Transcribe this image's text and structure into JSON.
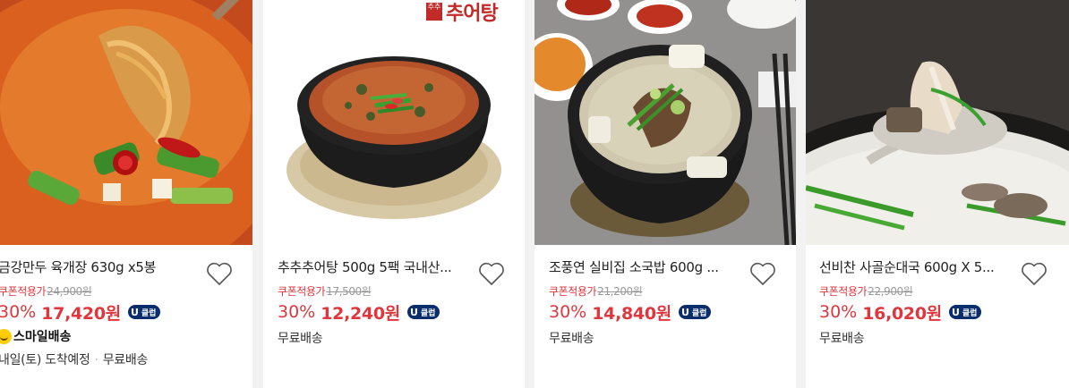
{
  "products": [
    {
      "title": "금강만두 육개장 630g x5봉",
      "coupon_label": "쿠폰적용가",
      "original_price": "24,900원",
      "discount": "30%",
      "sale_price": "17,420원",
      "badge": {
        "icon": "U",
        "text": "클럽"
      },
      "smile_delivery": "스마일배송",
      "arrival": "내일(토) 도착예정",
      "separator": "·",
      "shipping": "무료배송",
      "heart_icon": "heart-outline-icon"
    },
    {
      "title": "추추추어탕 500g 5팩 국내산...",
      "coupon_label": "쿠폰적용가",
      "original_price": "17,500원",
      "discount": "30%",
      "sale_price": "12,240원",
      "badge": {
        "icon": "U",
        "text": "클럽"
      },
      "shipping": "무료배송",
      "brand_logo_text": "추어탕",
      "brand_seal": "추추",
      "heart_icon": "heart-outline-icon"
    },
    {
      "title": "조풍연 실비집 소국밥 600g ...",
      "coupon_label": "쿠폰적용가",
      "original_price": "21,200원",
      "discount": "30%",
      "sale_price": "14,840원",
      "badge": {
        "icon": "U",
        "text": "클럽"
      },
      "shipping": "무료배송",
      "heart_icon": "heart-outline-icon"
    },
    {
      "title": "선비찬 사골순대국 600g X 5...",
      "coupon_label": "쿠폰적용가",
      "original_price": "22,900원",
      "discount": "30%",
      "sale_price": "16,020원",
      "badge": {
        "icon": "U",
        "text": "클럽"
      },
      "shipping": "무료배송",
      "heart_icon": "heart-outline-icon"
    }
  ],
  "colors": {
    "accent_red": "#e0363d",
    "uclub_navy": "#0a2d6b",
    "smile_yellow": "#ffcc00"
  }
}
